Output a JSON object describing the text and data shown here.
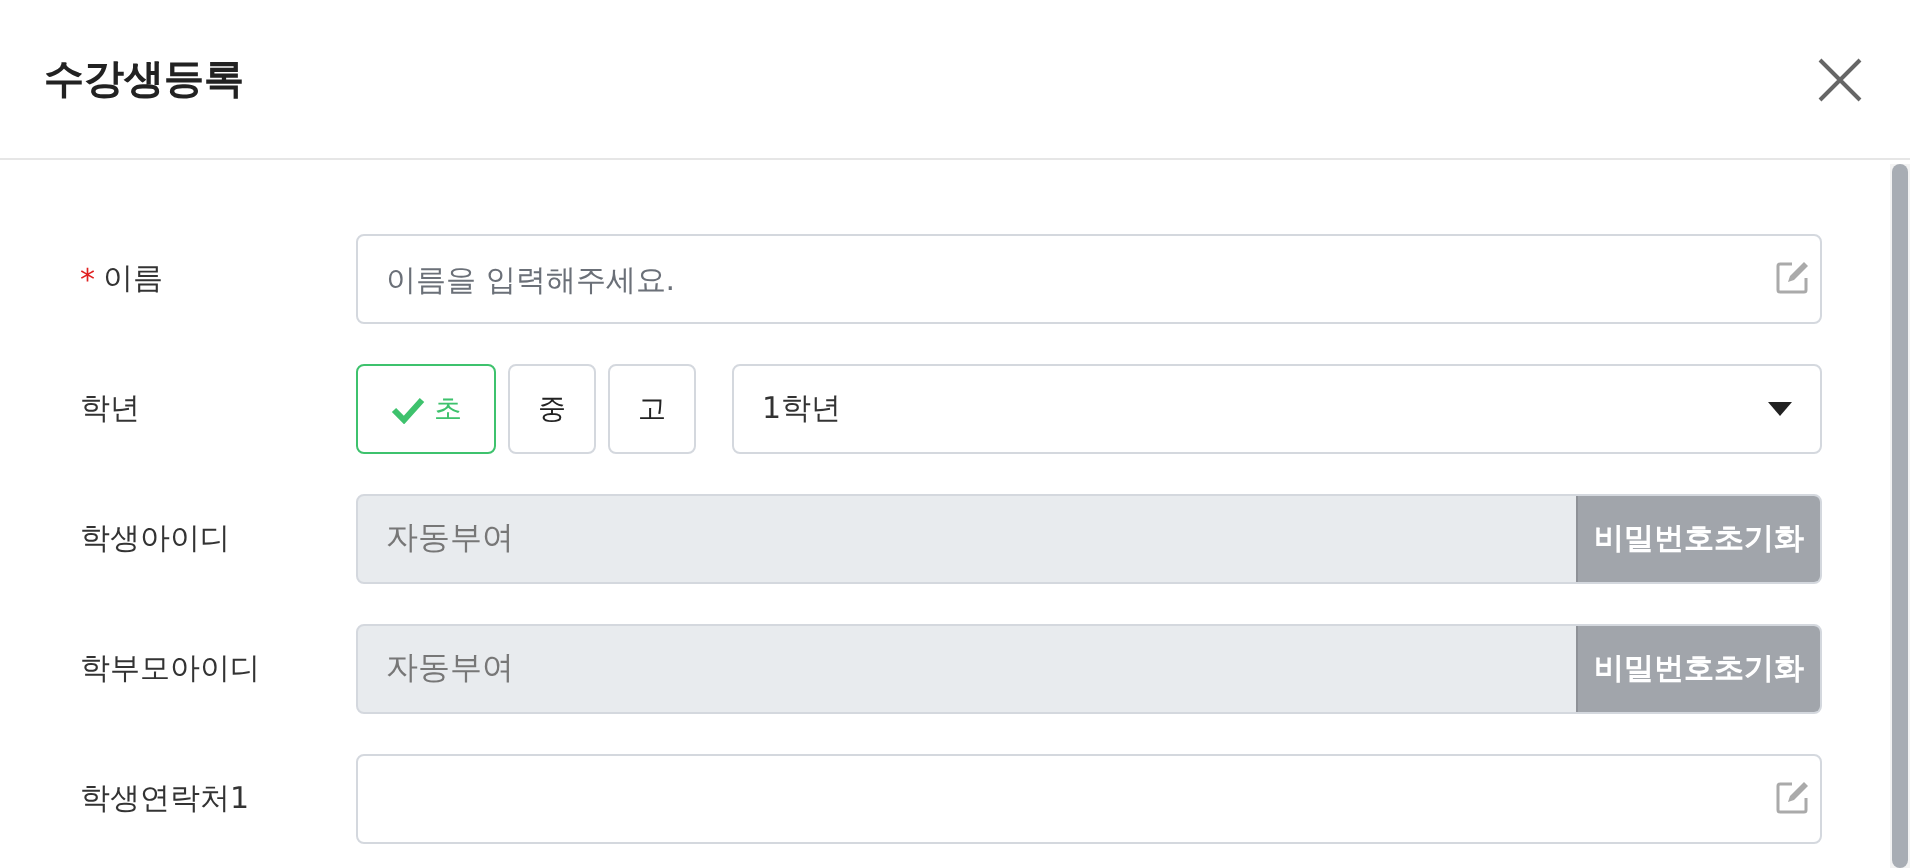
{
  "window": {
    "title": "수강생등록"
  },
  "rows": [
    {
      "kind": "text",
      "label": "이름",
      "required_mark": "*",
      "placeholder": "이름을 입력해주세요."
    },
    {
      "kind": "level",
      "label": "학년",
      "options": [
        {
          "label": "초",
          "selected": true
        },
        {
          "label": "중",
          "selected": false
        },
        {
          "label": "고",
          "selected": false
        }
      ],
      "select": "1학년"
    },
    {
      "kind": "readonly",
      "label": "학생아이디",
      "value": "자동부여",
      "button": "비밀번호초기화"
    },
    {
      "kind": "readonly",
      "label": "학부모아이디",
      "value": "자동부여",
      "button": "비밀번호초기화"
    },
    {
      "kind": "text",
      "label": "학생연락처1"
    }
  ]
}
